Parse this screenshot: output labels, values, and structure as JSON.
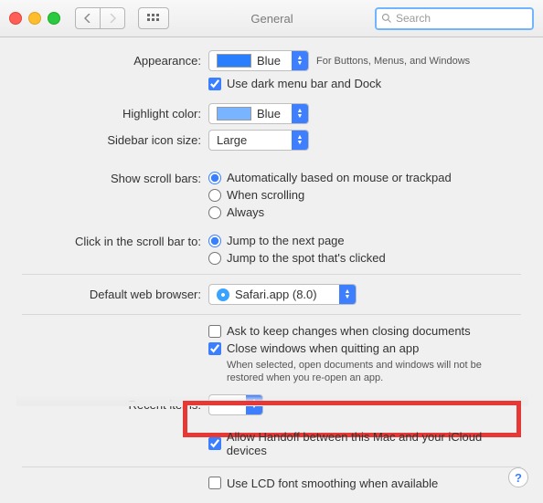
{
  "window": {
    "title": "General"
  },
  "search": {
    "placeholder": "Search"
  },
  "appearance": {
    "label": "Appearance:",
    "value": "Blue",
    "hint": "For Buttons, Menus, and Windows",
    "dark_menu_label": "Use dark menu bar and Dock",
    "dark_menu_checked": true
  },
  "highlight": {
    "label": "Highlight color:",
    "value": "Blue"
  },
  "sidebar_icon": {
    "label": "Sidebar icon size:",
    "value": "Large"
  },
  "scrollbars": {
    "label": "Show scroll bars:",
    "options": {
      "auto": "Automatically based on mouse or trackpad",
      "scrolling": "When scrolling",
      "always": "Always"
    },
    "selected": "auto"
  },
  "scroll_click": {
    "label": "Click in the scroll bar to:",
    "options": {
      "next_page": "Jump to the next page",
      "spot": "Jump to the spot that's clicked"
    },
    "selected": "next_page"
  },
  "browser": {
    "label": "Default web browser:",
    "value": "Safari.app (8.0)"
  },
  "documents": {
    "ask_save_label": "Ask to keep changes when closing documents",
    "ask_save_checked": false,
    "close_windows_label": "Close windows when quitting an app",
    "close_windows_checked": true,
    "close_windows_hint": "When selected, open documents and windows will not be restored when you re-open an app."
  },
  "recent": {
    "label": "Recent items:"
  },
  "handoff": {
    "label": "Allow Handoff between this Mac and your iCloud devices",
    "checked": true
  },
  "lcd": {
    "label": "Use LCD font smoothing when available",
    "checked": false
  }
}
